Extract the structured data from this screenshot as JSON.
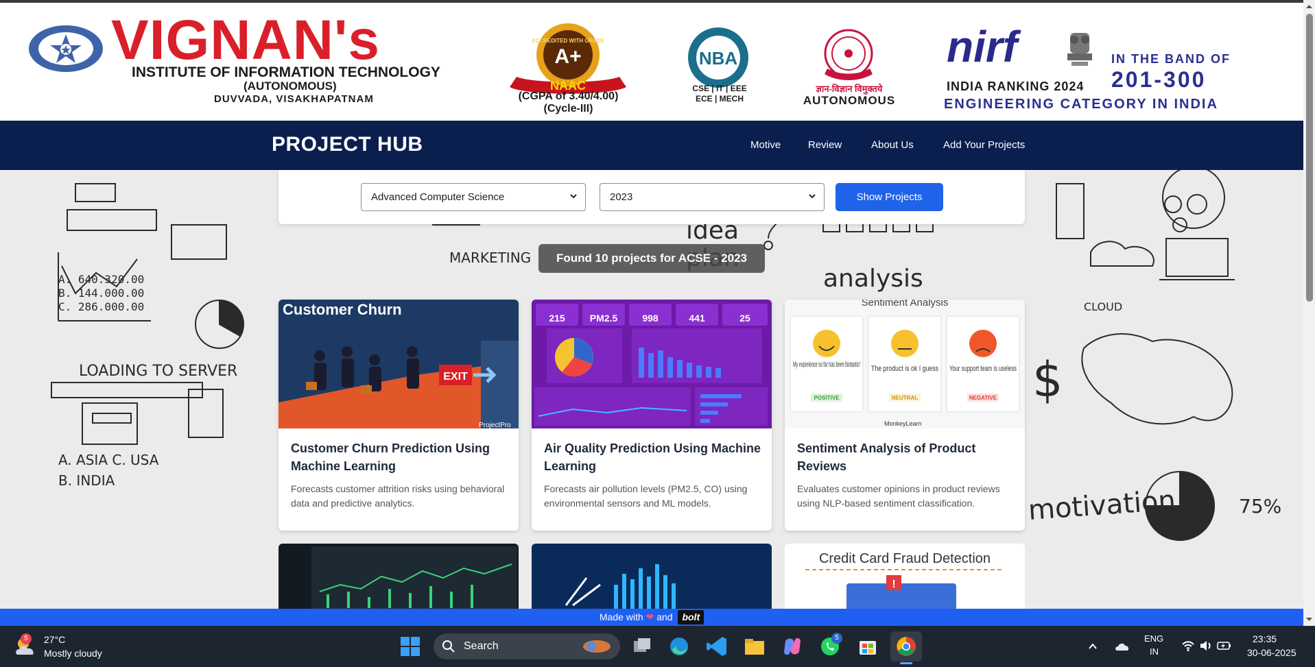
{
  "header": {
    "college_name": "VIGNAN's",
    "institute_line": "INSTITUTE OF INFORMATION TECHNOLOGY",
    "autonomous_line": "(AUTONOMOUS)",
    "location_line": "DUVVADA, VISAKHAPATNAM",
    "naac_grade": "A+",
    "naac_label": "NAAC",
    "naac_ring": "ACCREDITED WITH GRADE",
    "naac_cgpa": "(CGPA of 3.40/4.00)",
    "naac_cycle": "(Cycle-III)",
    "nba_label": "NBA",
    "nba_branches_1": "CSE | IT | EEE",
    "nba_branches_2": "ECE | MECH",
    "autonomous_hindi": "ज्ञान-विज्ञान विमुक्तये",
    "autonomous_text": "AUTONOMOUS",
    "nirf_logo": "nirf",
    "nirf_band": "IN THE BAND OF",
    "nirf_range": "201-300",
    "nirf_ranking": "INDIA RANKING 2024",
    "nirf_category": "ENGINEERING CATEGORY IN INDIA"
  },
  "navbar": {
    "brand": "PROJECT HUB",
    "links": [
      "Motive",
      "Review",
      "About Us",
      "Add Your Projects"
    ]
  },
  "filters": {
    "department_selected": "Advanced Computer Science",
    "year_selected": "2023",
    "show_button": "Show Projects"
  },
  "results": {
    "found_text": "Found 10 projects for ACSE - 2023"
  },
  "projects": [
    {
      "image_heading": "Customer Churn",
      "image_exit": "EXIT",
      "image_watermark": "ProjectPro",
      "title": "Customer Churn Prediction Using Machine Learning",
      "description": "Forecasts customer attrition risks using behavioral data and predictive analytics."
    },
    {
      "image_stats": [
        "215",
        "PM2.5",
        "998",
        "441",
        "25"
      ],
      "title": "Air Quality Prediction Using Machine Learning",
      "description": "Forecasts air pollution levels (PM2.5, CO) using environmental sensors and ML models."
    },
    {
      "image_heading": "Sentiment Analysis",
      "image_quotes": [
        "My experience so far has been fantastic!",
        "The product is ok I guess",
        "Your support team is useless"
      ],
      "image_tags": [
        "POSITIVE",
        "NEUTRAL",
        "NEGATIVE"
      ],
      "image_brand": "MonkeyLearn",
      "title": "Sentiment Analysis of Product Reviews",
      "description": "Evaluates customer opinions in product reviews using NLP-based sentiment classification."
    },
    {
      "image_heading": ""
    },
    {
      "image_heading": ""
    },
    {
      "image_heading": "Credit Card Fraud Detection"
    }
  ],
  "footer_bar": {
    "made_with": "Made with",
    "and": "and",
    "bolt": "bolt"
  },
  "taskbar": {
    "weather_temp": "27°C",
    "weather_desc": "Mostly cloudy",
    "weather_badge": "5",
    "search_label": "Search",
    "whatsapp_badge": "5",
    "lang_1": "ENG",
    "lang_2": "IN",
    "time": "23:35",
    "date": "30-06-2025"
  }
}
